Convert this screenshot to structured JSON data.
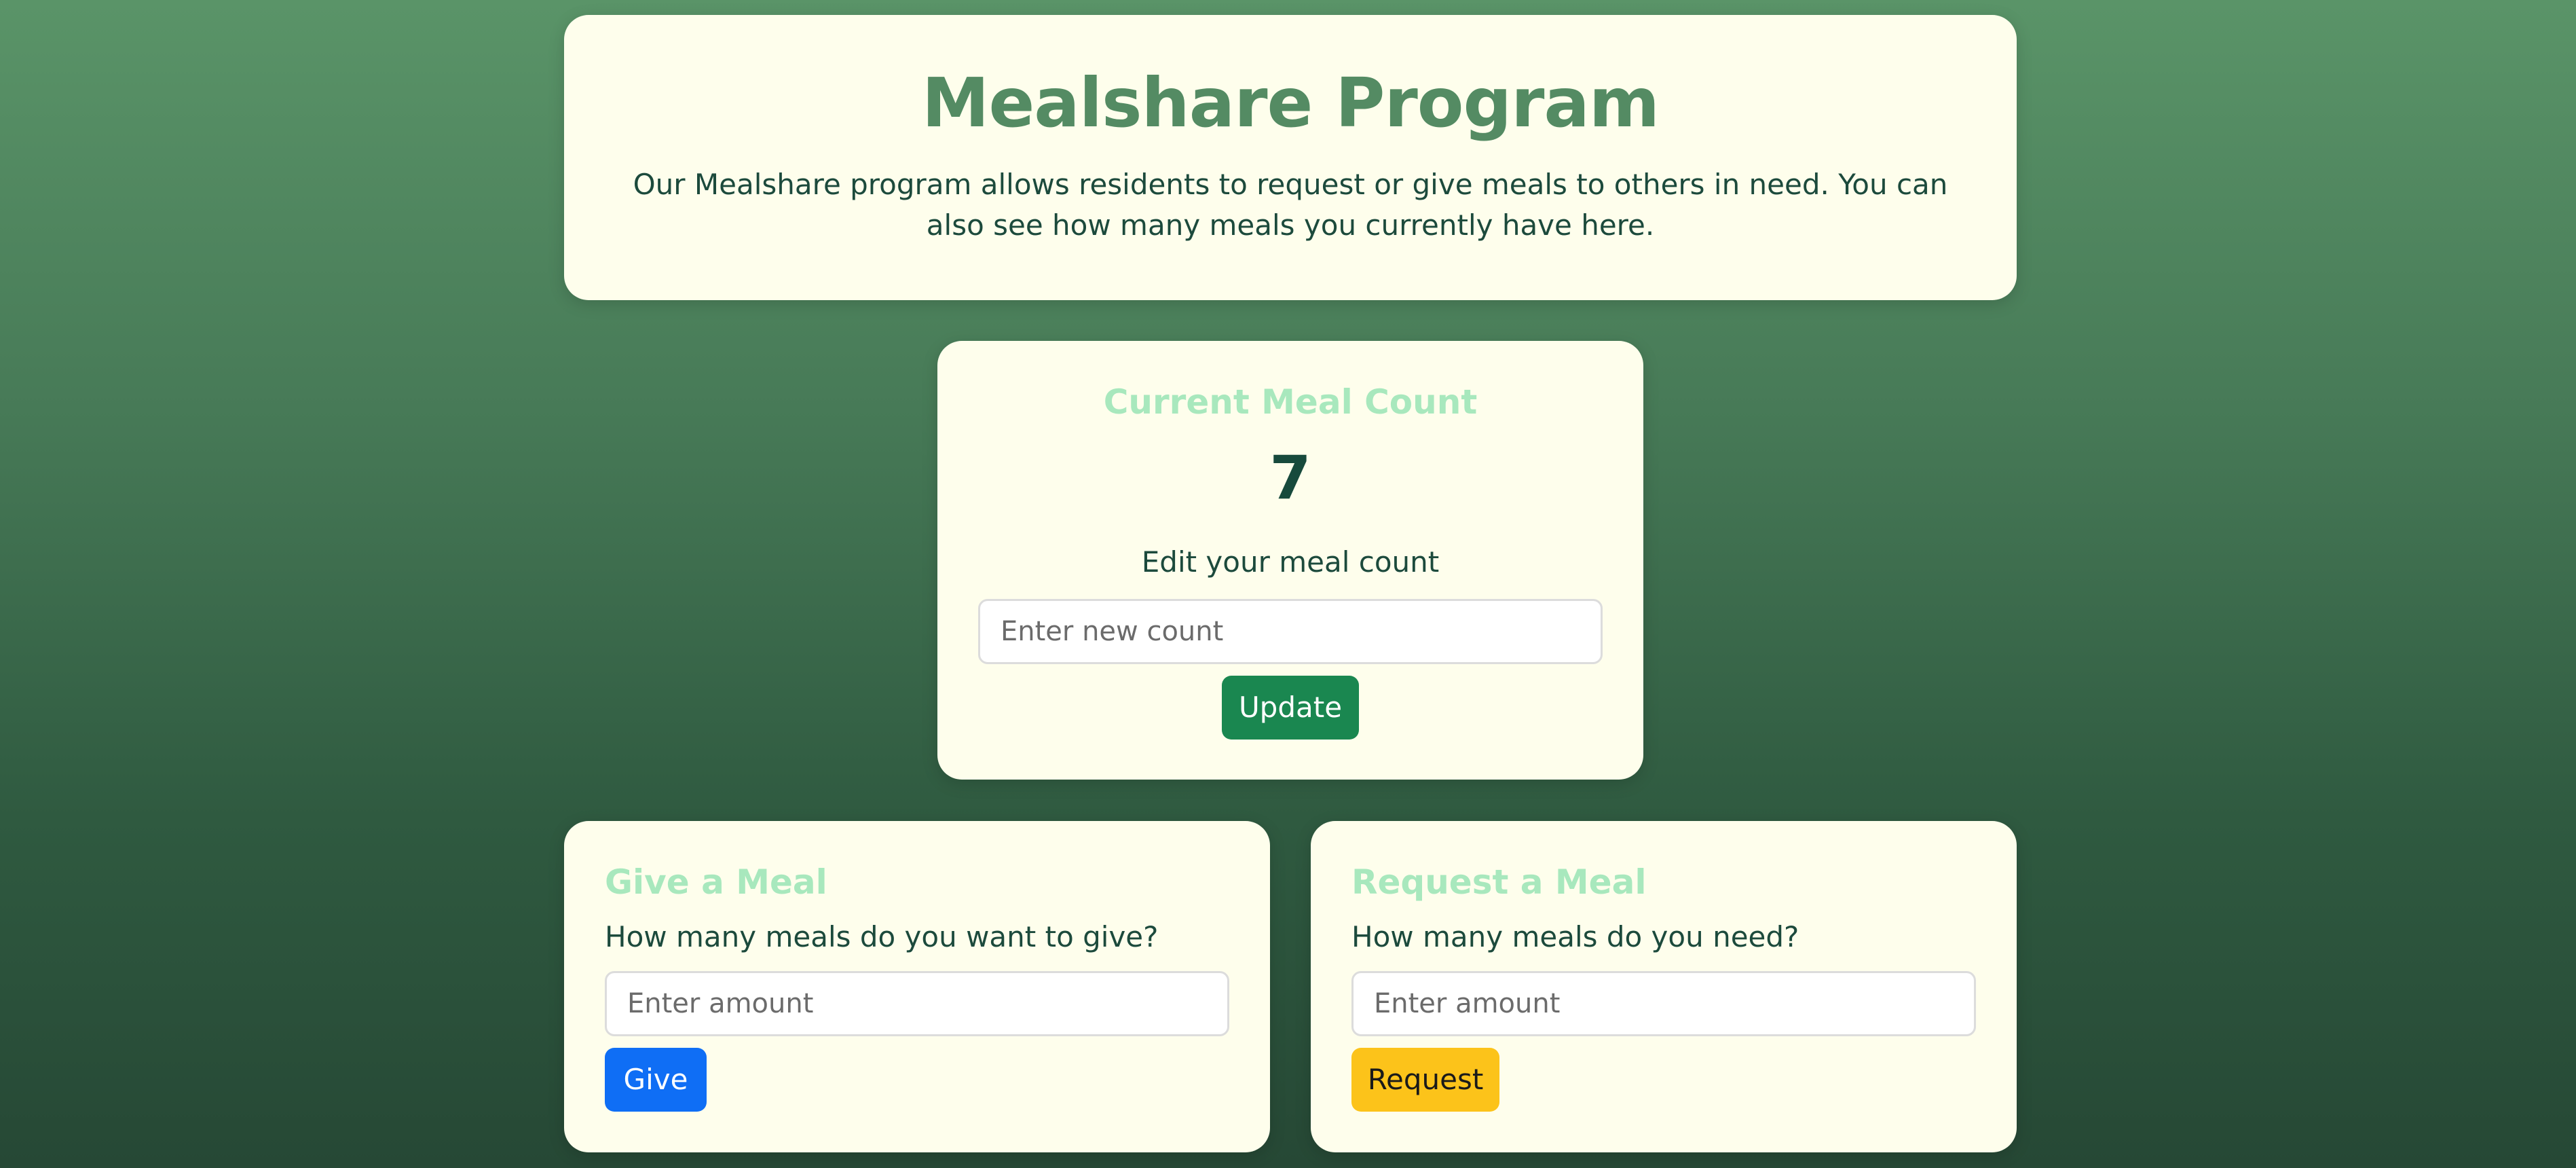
{
  "intro": {
    "title": "Mealshare Program",
    "description": "Our Mealshare program allows residents to request or give meals to others in need. You can also see how many meals you currently have here."
  },
  "meal_count": {
    "title": "Current Meal Count",
    "value": "7",
    "edit_label": "Edit your meal count",
    "input_placeholder": "Enter new count",
    "update_label": "Update"
  },
  "give": {
    "title": "Give a Meal",
    "question": "How many meals do you want to give?",
    "input_placeholder": "Enter amount",
    "button_label": "Give"
  },
  "request": {
    "title": "Request a Meal",
    "question": "How many meals do you need?",
    "input_placeholder": "Enter amount",
    "button_label": "Request"
  },
  "colors": {
    "title_green": "#548b63",
    "card_background": "#fefeec",
    "section_title_mint": "#a8e8bd",
    "update_button": "#1a8750",
    "give_button": "#0f6ef5",
    "request_button": "#fcc31a"
  }
}
